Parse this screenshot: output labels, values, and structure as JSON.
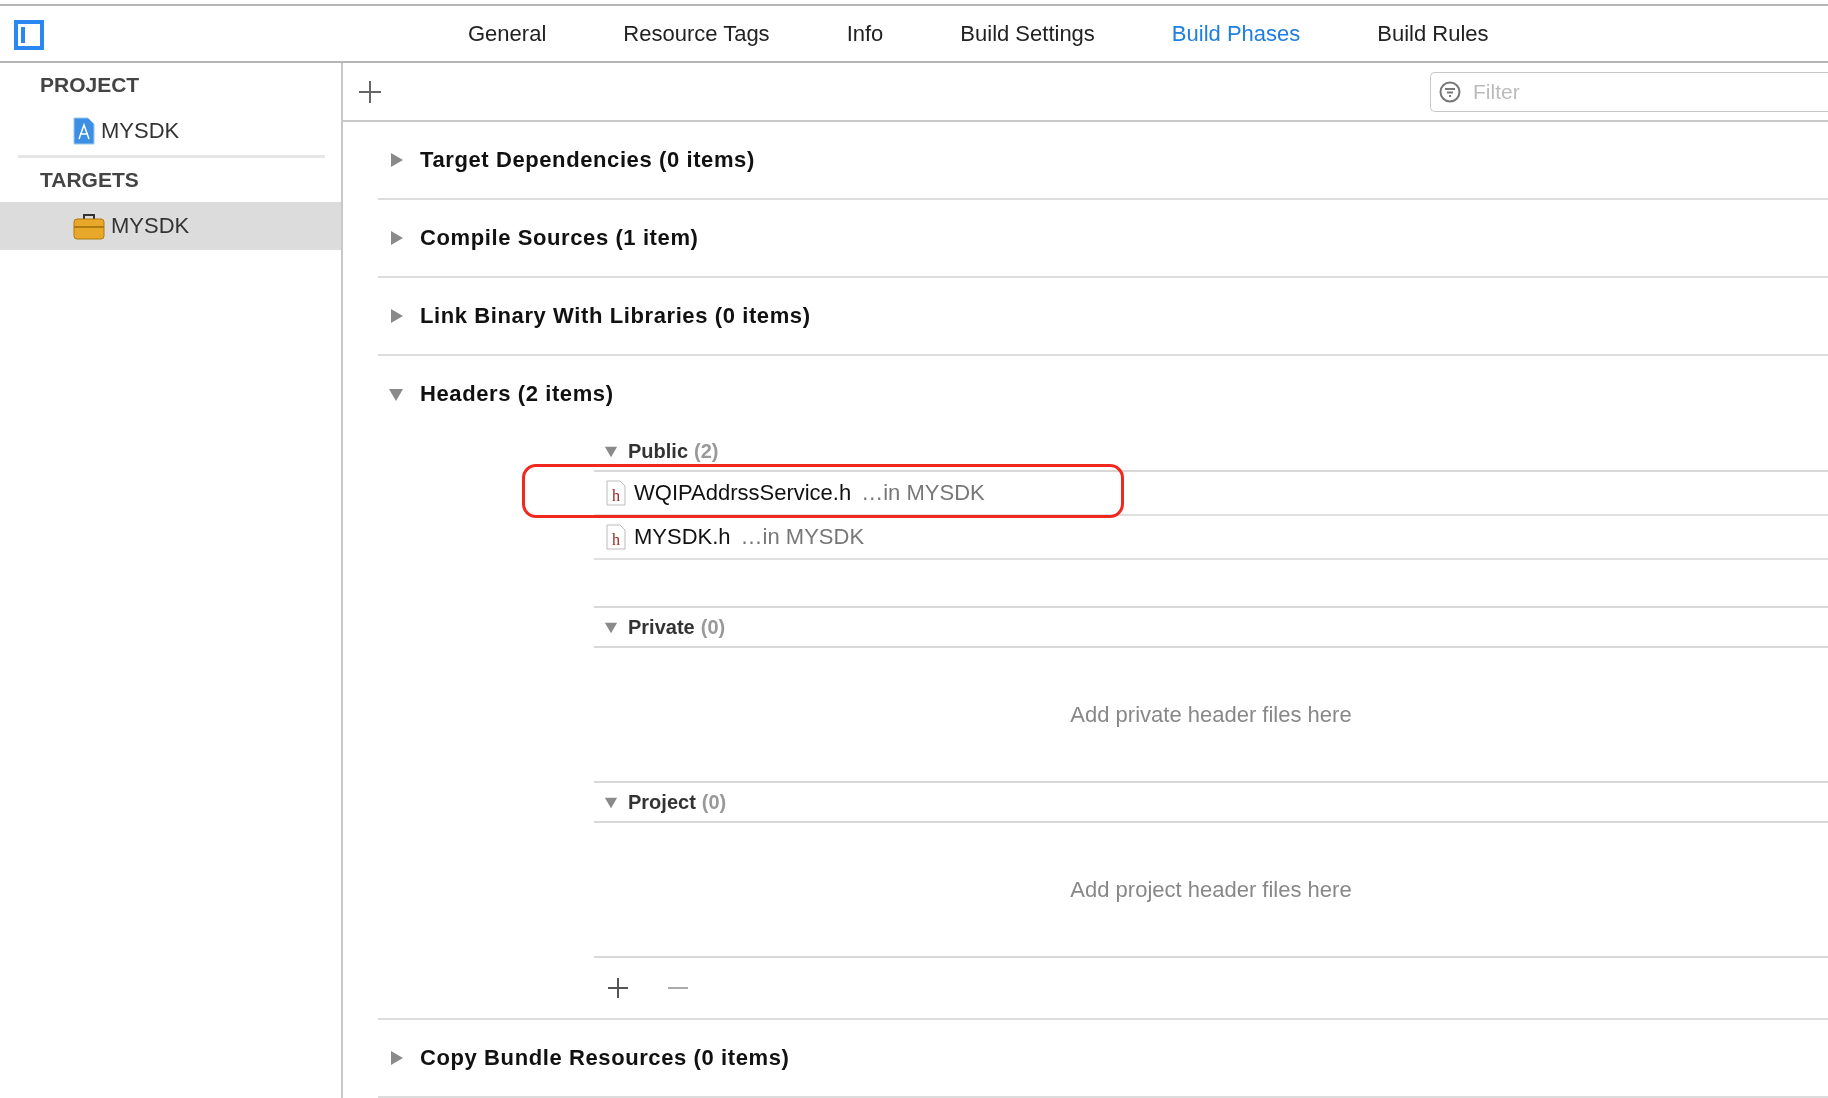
{
  "tabs": [
    {
      "label": "General",
      "selected": false
    },
    {
      "label": "Resource Tags",
      "selected": false
    },
    {
      "label": "Info",
      "selected": false
    },
    {
      "label": "Build Settings",
      "selected": false
    },
    {
      "label": "Build Phases",
      "selected": true
    },
    {
      "label": "Build Rules",
      "selected": false
    }
  ],
  "sidebar": {
    "sections": [
      {
        "title": "PROJECT",
        "items": [
          {
            "label": "MYSDK",
            "kind": "project",
            "selected": false
          }
        ]
      },
      {
        "title": "TARGETS",
        "items": [
          {
            "label": "MYSDK",
            "kind": "target",
            "selected": true
          }
        ]
      }
    ]
  },
  "filter": {
    "placeholder": "Filter"
  },
  "phases": [
    {
      "title": "Target Dependencies (0 items)",
      "expanded": false
    },
    {
      "title": "Compile Sources (1 item)",
      "expanded": false
    },
    {
      "title": "Link Binary With Libraries (0 items)",
      "expanded": false
    },
    {
      "title": "Headers (2 items)",
      "expanded": true,
      "groups": [
        {
          "name": "Public",
          "count": "(2)",
          "expanded": true,
          "files": [
            {
              "name": "WQIPAddrssService.h",
              "type_letter": "h",
              "location": "…in MYSDK",
              "highlighted": true
            },
            {
              "name": "MYSDK.h",
              "type_letter": "h",
              "location": "…in MYSDK",
              "highlighted": false
            }
          ]
        },
        {
          "name": "Private",
          "count": "(0)",
          "expanded": true,
          "empty_hint": "Add private header files here"
        },
        {
          "name": "Project",
          "count": "(0)",
          "expanded": true,
          "empty_hint": "Add project header files here"
        }
      ]
    },
    {
      "title": "Copy Bundle Resources (0 items)",
      "expanded": false
    }
  ]
}
